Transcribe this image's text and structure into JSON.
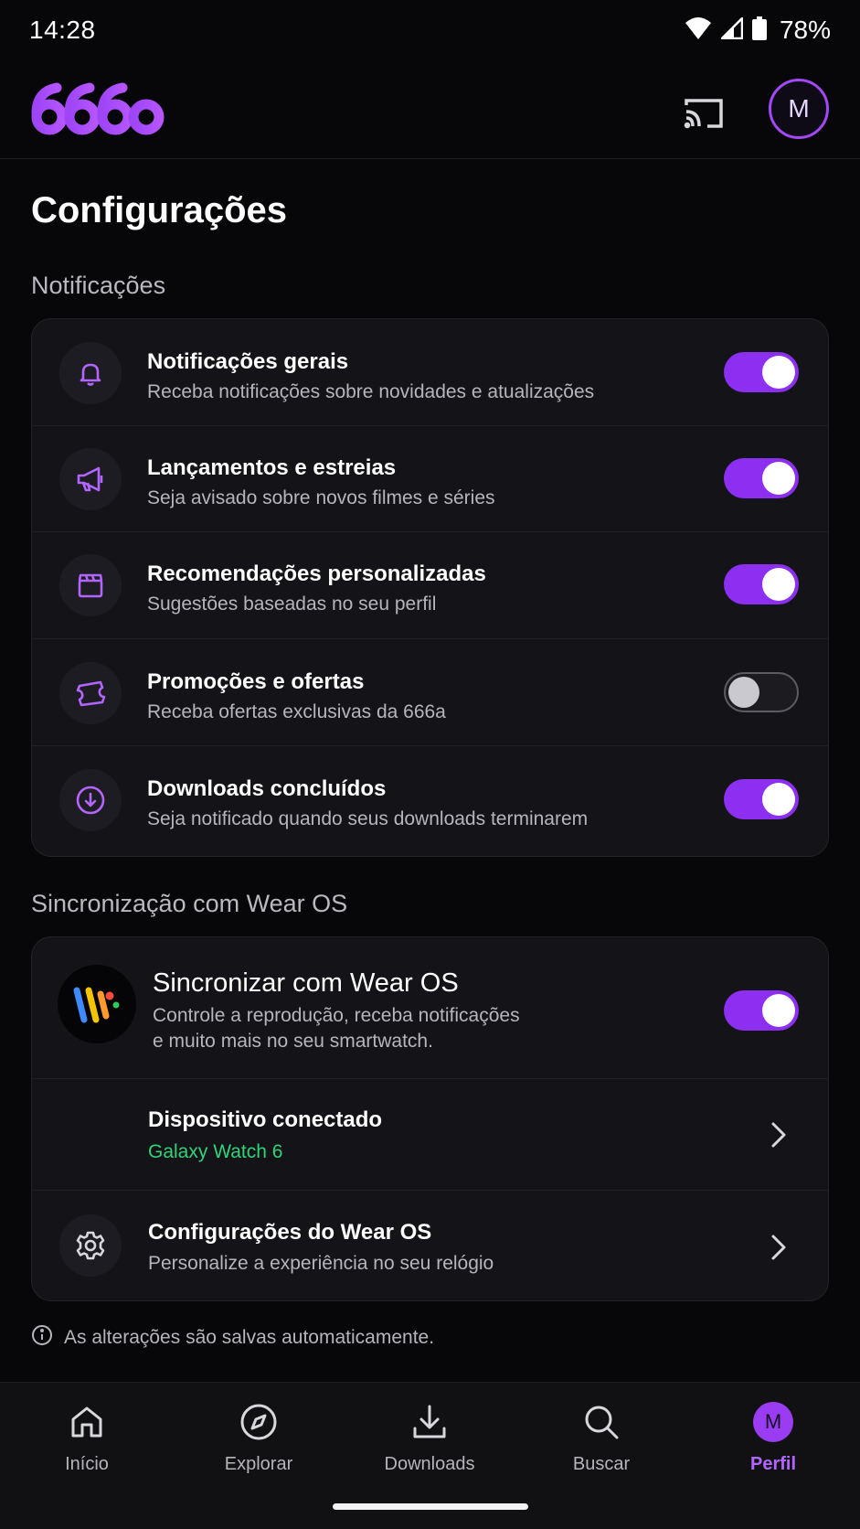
{
  "status_bar": {
    "time": "14:28",
    "battery": "78%"
  },
  "header": {
    "logo_text": "666a",
    "avatar_initial": "M"
  },
  "page_title": "Configurações",
  "notifications_section": {
    "title": "Notificações",
    "items": [
      {
        "title": "Notificações gerais",
        "subtitle": "Receba notificações sobre novidades e atualizações",
        "icon": "bell-icon",
        "enabled": true
      },
      {
        "title": "Lançamentos e estreias",
        "subtitle": "Seja avisado sobre novos filmes e séries",
        "icon": "megaphone-icon",
        "enabled": true
      },
      {
        "title": "Recomendações personalizadas",
        "subtitle": "Sugestões baseadas no seu perfil",
        "icon": "clapperboard-icon",
        "enabled": true
      },
      {
        "title": "Promoções e ofertas",
        "subtitle": "Receba ofertas exclusivas da 666a",
        "icon": "ticket-icon",
        "enabled": false
      },
      {
        "title": "Downloads concluídos",
        "subtitle": "Seja notificado quando seus downloads terminarem",
        "icon": "download-circle-icon",
        "enabled": true
      }
    ]
  },
  "wear_section": {
    "title": "Sincronização com Wear OS",
    "sync": {
      "title": "Sincronizar com Wear OS",
      "subtitle_line1": "Controle a reprodução, receba notificações",
      "subtitle_line2": "e muito mais no seu smartwatch.",
      "enabled": true
    },
    "device": {
      "title": "Dispositivo conectado",
      "value": "Galaxy Watch 6"
    },
    "settings": {
      "title": "Configurações do Wear OS",
      "subtitle": "Personalize a experiência no seu relógio"
    }
  },
  "info_text": "As alterações são salvas automaticamente.",
  "bottom_nav": {
    "items": [
      {
        "label": "Início"
      },
      {
        "label": "Explorar"
      },
      {
        "label": "Downloads"
      },
      {
        "label": "Buscar"
      },
      {
        "label": "Perfil",
        "initial": "M"
      }
    ]
  },
  "colors": {
    "accent": "#8c2ff0",
    "accent_text": "#b366ff",
    "connected_green": "#2fd47a",
    "background": "#07070a",
    "card": "#141418"
  }
}
